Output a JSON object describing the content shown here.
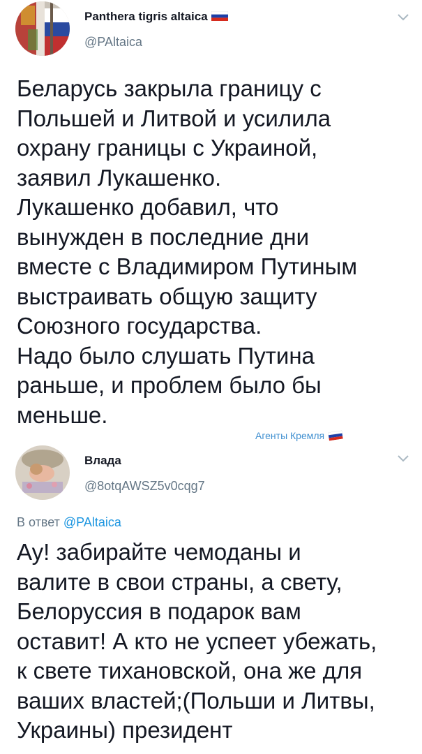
{
  "tweet1": {
    "author_name": "Panthera tigris altaica",
    "author_handle": "@PAltaica",
    "flag_icon": "russian-flag-icon",
    "menu_icon": "chevron-down-icon",
    "lines": [
      "Беларусь закрыла границу с",
      "Польшей и Литвой и усилила",
      "охрану границы с Украиной,",
      "заявил Лукашенко.",
      "Лукашенко добавил, что",
      "вынужден в последние дни",
      "вместе с Владимиром Путиным",
      "выстраивать общую защиту",
      "Союзного государства.",
      "Надо было слушать Путина",
      "раньше, и проблем было бы",
      "меньше."
    ]
  },
  "watermark": {
    "text": "Агенты Кремля",
    "flag_icon": "russian-flag-icon"
  },
  "tweet2": {
    "author_name": "Влада",
    "author_handle": "@8otqAWSZ5v0cqg7",
    "menu_icon": "chevron-down-icon",
    "reply_prefix": "В ответ",
    "reply_mention": "@PAltaica",
    "lines": [
      "Ау! забирайте чемоданы и",
      "валите в свои страны, а свету,",
      "Белоруссия в подарок вам",
      "оставит! А кто не успеет убежать,",
      "к свете тихановской, она же для",
      "ваших властей;(Польши и Литвы,",
      "Украины) президент"
    ]
  },
  "colors": {
    "text": "#141823",
    "secondary": "#657786",
    "link": "#1b95e0",
    "watermark": "#3f8fd0"
  }
}
